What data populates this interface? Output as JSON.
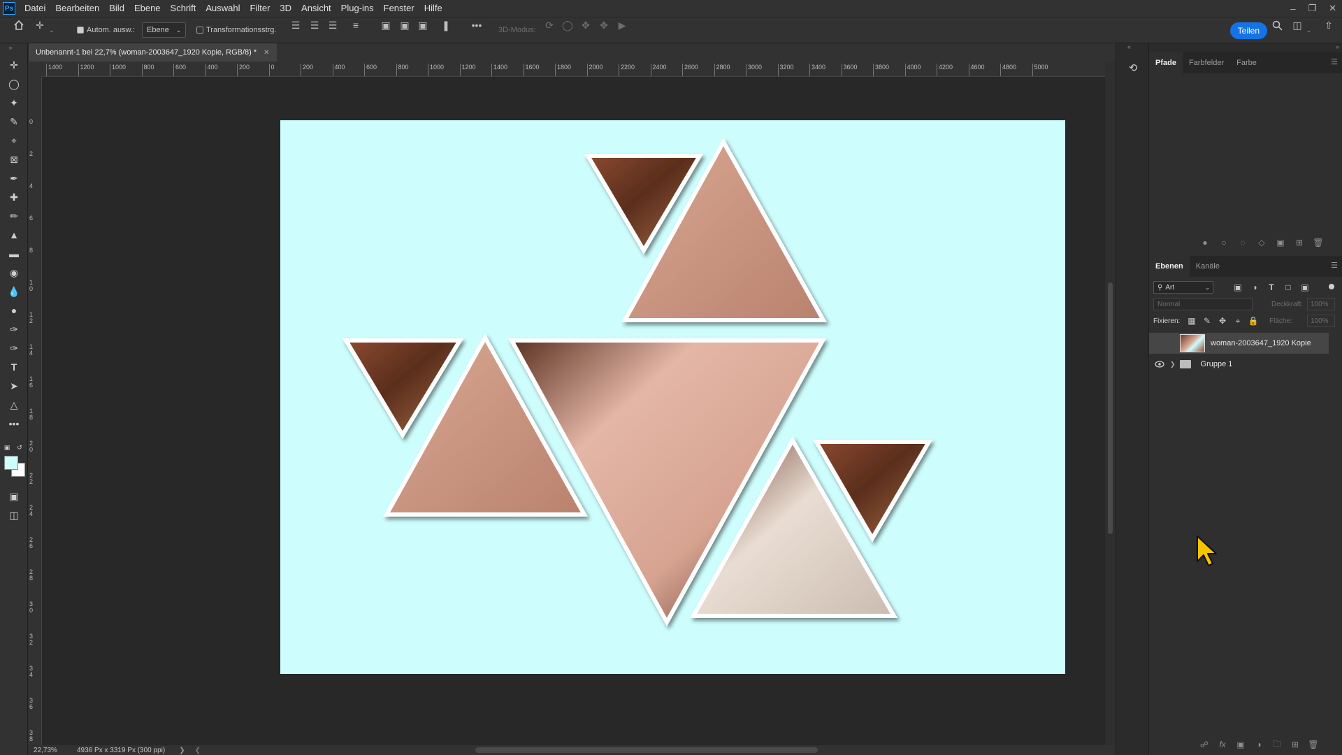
{
  "app": {
    "logo": "Ps"
  },
  "menu": [
    "Datei",
    "Bearbeiten",
    "Bild",
    "Ebene",
    "Schrift",
    "Auswahl",
    "Filter",
    "3D",
    "Ansicht",
    "Plug-ins",
    "Fenster",
    "Hilfe"
  ],
  "options": {
    "auto_select_label": "Autom. ausw.:",
    "auto_select_target": "Ebene",
    "transform_label": "Transformationsstrg.",
    "mode_3d_label": "3D-Modus:",
    "share_label": "Teilen"
  },
  "document": {
    "tab_title": "Unbenannt-1 bei 22,7% (woman-2003647_1920 Kopie, RGB/8) *",
    "canvas_bg": "#cdfdfd"
  },
  "ruler": {
    "top_labels": [
      "1400",
      "1200",
      "1000",
      "800",
      "600",
      "400",
      "200",
      "0",
      "200",
      "400",
      "600",
      "800",
      "1000",
      "1200",
      "1400",
      "1600",
      "1800",
      "2000",
      "2200",
      "2400",
      "2600",
      "2800",
      "3000",
      "3200",
      "3400",
      "3600",
      "3800",
      "4000",
      "4200",
      "4600",
      "4800",
      "5000"
    ],
    "left_labels": [
      "0",
      "2",
      "4",
      "6",
      "8",
      "1 0",
      "1 2",
      "1 4",
      "1 6",
      "1 8",
      "2 0",
      "2 2",
      "2 4",
      "2 6",
      "2 8",
      "3 0",
      "3 2",
      "3 4",
      "3 6",
      "3 8"
    ]
  },
  "status": {
    "zoom": "22,73%",
    "doc_size": "4936 Px x 3319 Px (300 ppi)"
  },
  "panels_top": {
    "tabs": [
      "Pfade",
      "Farbfelder",
      "Farbe"
    ],
    "active": "Pfade"
  },
  "layers_panel": {
    "tabs": [
      "Ebenen",
      "Kanäle"
    ],
    "active": "Ebenen",
    "filter_label": "Art",
    "blend_mode": "Normal",
    "opacity_label": "Deckkraft:",
    "opacity_value": "100%",
    "lock_label": "Fixieren:",
    "fill_label": "Fläche:",
    "fill_value": "100%",
    "layers": [
      {
        "name": "woman-2003647_1920 Kopie",
        "visible": false,
        "selected": true,
        "type": "image"
      },
      {
        "name": "Gruppe 1",
        "visible": true,
        "selected": false,
        "type": "group"
      }
    ]
  },
  "colors": {
    "accent": "#1473e6",
    "foreground": "#cdfdfd",
    "background": "#ffffff"
  }
}
